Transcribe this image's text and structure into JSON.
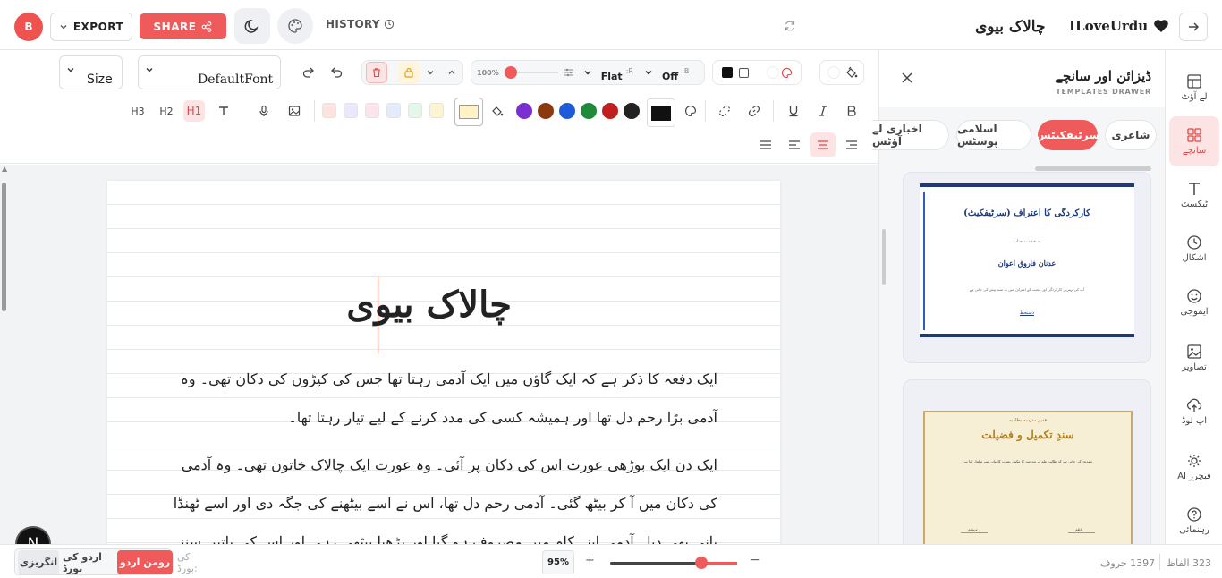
{
  "header": {
    "avatar_letter": "B",
    "export_label": "EXPORT",
    "share_label": "SHARE",
    "history_label": "HISTORY",
    "document_title": "چالاک بیوی",
    "brand_name": "ILoveUrdu"
  },
  "toolbar": {
    "size_label": "Size",
    "font_label": "DefaultFont",
    "zoom_small": "100%",
    "style_label": "Flat",
    "style_shortcut": ":R",
    "off_label": "Off",
    "off_shortcut": ":B",
    "heading_labels": [
      "H3",
      "H2",
      "H1"
    ],
    "pastel_swatches": [
      "#fde2e2",
      "#ebe8fb",
      "#fce4ef",
      "#e4ecfb",
      "#e4f7e8",
      "#fdf4d2"
    ],
    "selected_swatch": "#fff2c6",
    "color_dots": [
      "#7b2fd0",
      "#8b3a10",
      "#1e5bd8",
      "#1e8a3a",
      "#c01f1f",
      "#222222"
    ],
    "text_color_box": "#111111"
  },
  "document": {
    "title": "چالاک بیوی",
    "paragraphs": [
      "ایک دفعہ کا ذکر ہے کہ ایک گاؤں میں ایک آدمی رہتا تھا جس کی کپڑوں کی دکان تھی۔ وہ آدمی بڑا رحم دل تھا اور ہمیشہ کسی کی مدد کرنے کے لیے تیار رہتا تھا۔",
      "ایک دن ایک بوڑھی عورت اس کی دکان پر آئی۔ وہ عورت ایک چالاک خاتون تھی۔ وہ آدمی کی دکان میں آ کر بیٹھ گئی۔ آدمی رحم دل تھا، اس نے اسے بیٹھنے کی جگہ دی اور اسے ٹھنڈا پانی بھی دیا۔ آدمی اپنے کام میں مصروف ہو گیا اور بڑھیا بیٹھی رہی اور اس کی باتیں سننے لگی۔ پھر ایک گاہک آیا جس نے کچھ خریدا۔"
    ]
  },
  "drawer": {
    "title": "ڈیزائن اور سانچے",
    "subtitle": "TEMPLATES DRAWER",
    "tabs": [
      "شاعری",
      "سرٹیفکیٹس",
      "اسلامی پوسٹس",
      "اخباری لے آؤٹس"
    ],
    "active_tab": "سرٹیفکیٹس",
    "cards": [
      {
        "heading": "کارکردگی کا اعتراف (سرٹیفکیٹ)",
        "sub": "بہ خدمت جناب",
        "name": "عدنان فاروق اعوان",
        "body": "آپ کی بہترین کارکردگی اور محنت کے اعتراف میں یہ سند پیش کی جاتی ہے",
        "signature": "دستخط"
      },
      {
        "heading": "قدیم مدرسہ نظامیہ",
        "title": "سندِ تکمیل و فضیلت",
        "body": "تصدیق کی جاتی ہے کہ طالب علم نے مدرسہ کا مکمل نصاب کامیابی سے مکمل کیا ہے",
        "left_sign": "مہتمم",
        "right_sign": "ناظم"
      }
    ]
  },
  "rail": {
    "items": [
      {
        "label": "لے آؤٹ",
        "icon": "layout-icon"
      },
      {
        "label": "سانچے",
        "icon": "grid-icon"
      },
      {
        "label": "ٹیکسٹ",
        "icon": "text-icon"
      },
      {
        "label": "اشکال",
        "icon": "shapes-icon"
      },
      {
        "label": "ایموجی",
        "icon": "emoji-icon"
      },
      {
        "label": "تصاویر",
        "icon": "image-icon"
      },
      {
        "label": "اپ لوڈ",
        "icon": "upload-icon"
      },
      {
        "label": "AI فیچرز",
        "icon": "ai-icon"
      },
      {
        "label": "رہنمائی",
        "icon": "help-icon"
      }
    ]
  },
  "statusbar": {
    "keyboard_english": "انگریزی",
    "keyboard_urdu": "اردو کی بورڈ",
    "keyboard_roman": "رومن اردو",
    "keyboard_label": "کی بورڈ:",
    "zoom": "95%",
    "zoom_in": "+",
    "zoom_out": "−",
    "zoom_fraction": 0.72,
    "char_count": "1397 حروف",
    "word_count": "323 الفاظ"
  },
  "colors": {
    "accent": "#ef5b5b",
    "text": "#222222"
  }
}
